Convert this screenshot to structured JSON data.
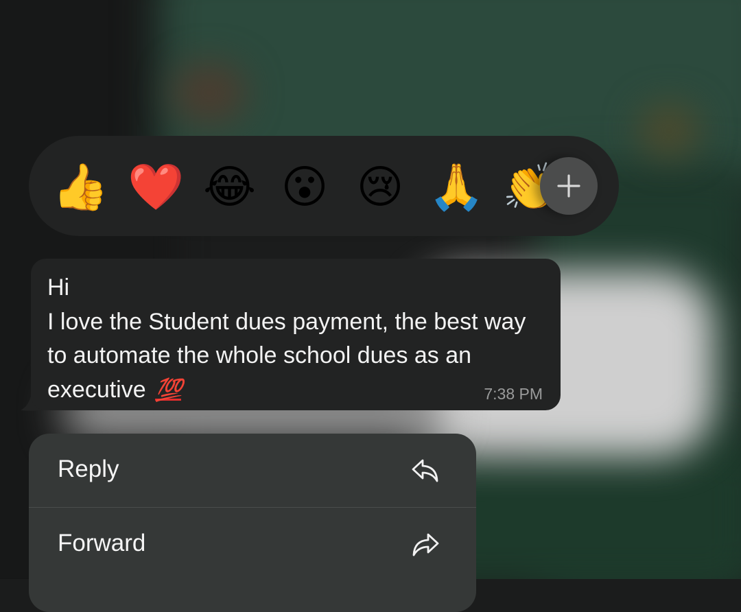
{
  "reactions": {
    "emojis": [
      {
        "name": "thumbs-up",
        "glyph": "👍"
      },
      {
        "name": "red-heart",
        "glyph": "❤️"
      },
      {
        "name": "face-with-tears-of-joy",
        "glyph": "😂"
      },
      {
        "name": "astonished-face",
        "glyph": "😮"
      },
      {
        "name": "crying-face",
        "glyph": "😢"
      },
      {
        "name": "folded-hands",
        "glyph": "🙏"
      },
      {
        "name": "clapping-hands",
        "glyph": "👏"
      }
    ],
    "more_icon": "plus-icon"
  },
  "message": {
    "text": "Hi\nI love the Student dues payment, the best way to automate the whole school dues as an executive",
    "emoji": "💯",
    "time": "7:38 PM"
  },
  "menu": {
    "items": [
      {
        "label": "Reply",
        "icon": "reply-icon"
      },
      {
        "label": "Forward",
        "icon": "forward-icon"
      }
    ]
  },
  "colors": {
    "bubble": "#222323",
    "menu": "#353837",
    "reaction_bar": "#222323",
    "plus_button": "#4b4c4c"
  }
}
